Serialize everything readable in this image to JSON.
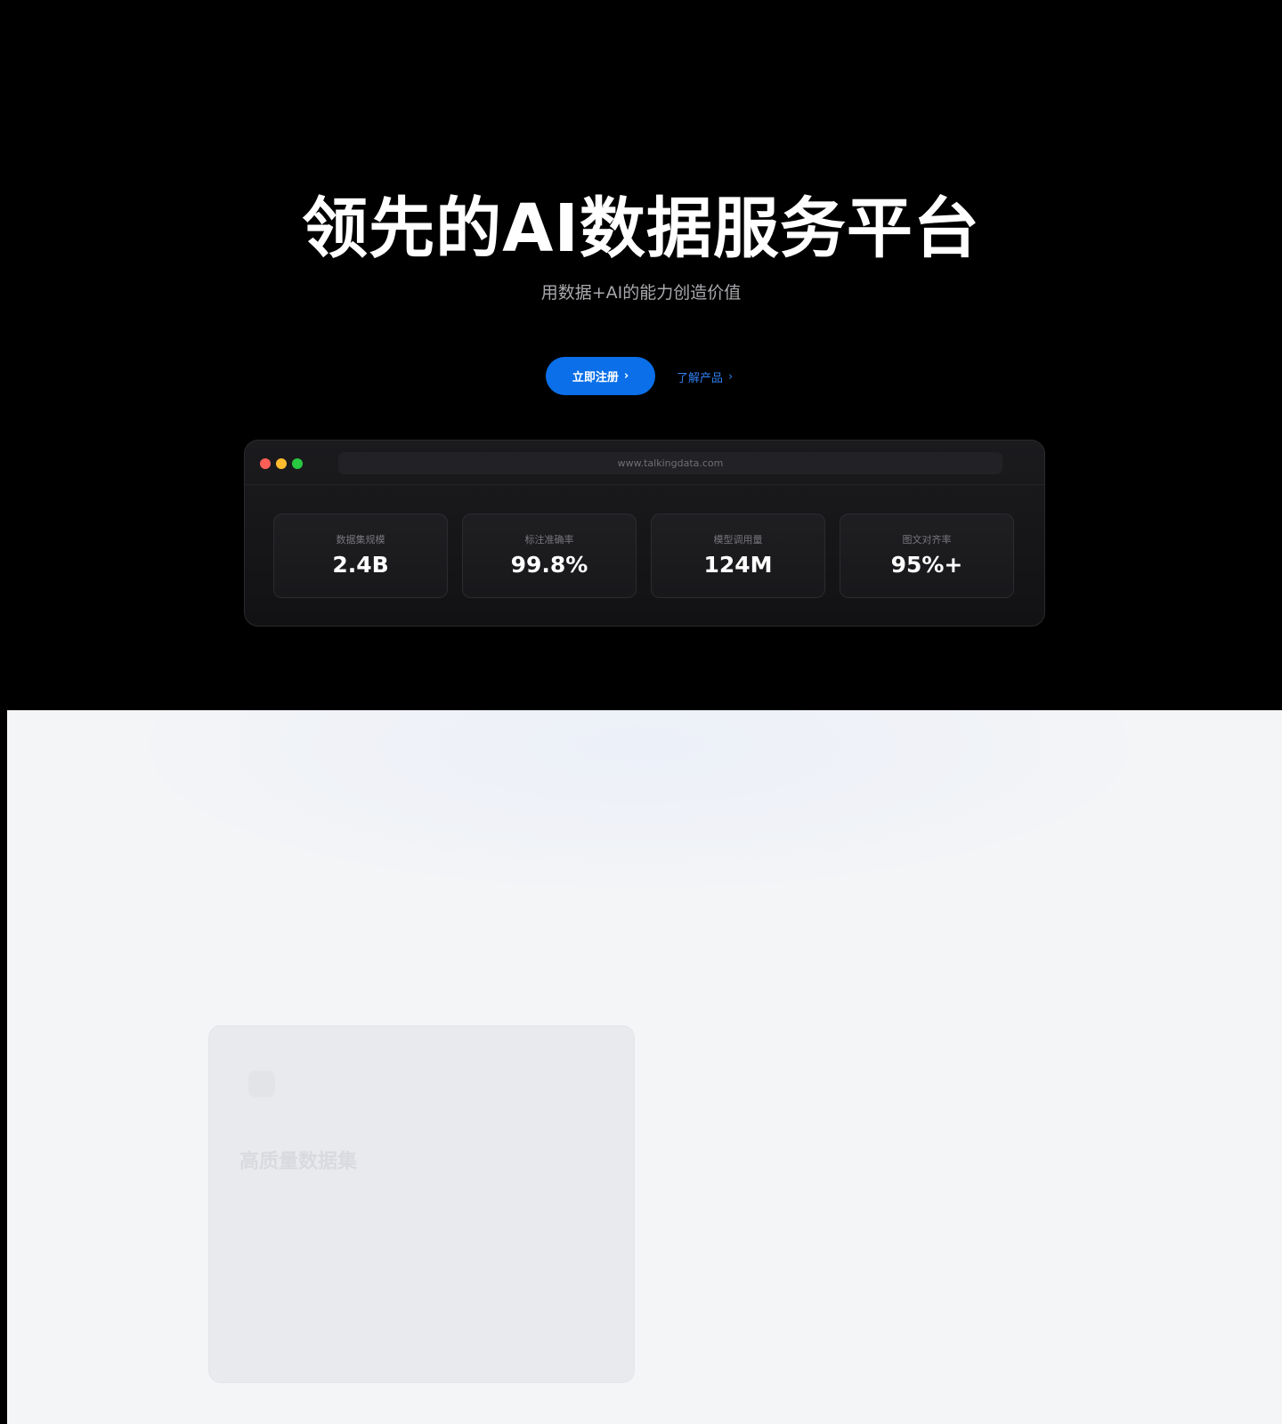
{
  "hero": {
    "title": "领先的AI数据服务平台",
    "subtitle": "用数据+AI的能力创造价值",
    "cta_primary": "立即注册",
    "cta_secondary": "了解产品",
    "chevron": "›"
  },
  "browser": {
    "url": "www.talkingdata.com",
    "stats": [
      {
        "label": "数据集规模",
        "value": "2.4B"
      },
      {
        "label": "标注准确率",
        "value": "99.8%"
      },
      {
        "label": "模型调用量",
        "value": "124M"
      },
      {
        "label": "图文对齐率",
        "value": "95%+"
      }
    ]
  },
  "section2": {
    "card": {
      "title": "高质量数据集"
    }
  },
  "colors": {
    "accent": "#0a6fe8",
    "hero_bg": "#000000",
    "section_bg": "#f4f5f7"
  }
}
